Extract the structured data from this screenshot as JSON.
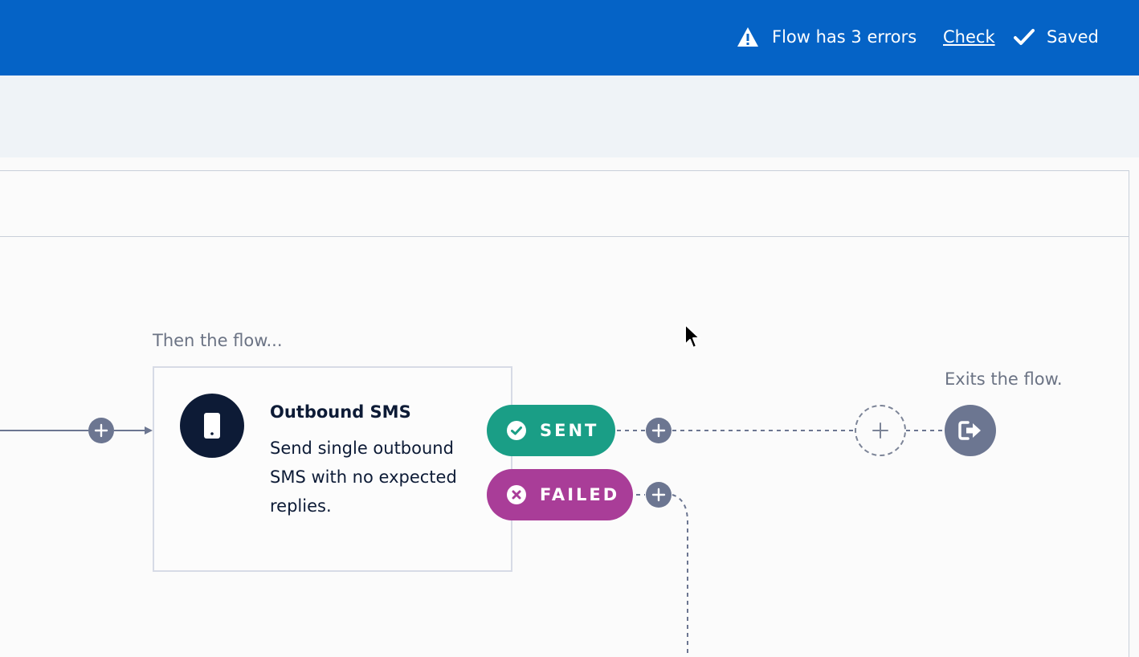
{
  "header": {
    "error_status": "Flow has 3 errors",
    "check_link": "Check",
    "saved_status": "Saved"
  },
  "canvas": {
    "then_label": "Then the flow...",
    "exits_label": "Exits the flow.",
    "node": {
      "title": "Outbound SMS",
      "description": "Send single outbound SMS with no expected replies."
    },
    "outcomes": [
      {
        "label": "SENT",
        "color": "#1a9e86"
      },
      {
        "label": "FAILED",
        "color": "#a93d98"
      }
    ]
  },
  "colors": {
    "header_bg": "#0563c6",
    "node_icon_bg": "#0d1b36",
    "connector": "#6c7691"
  },
  "icons": {
    "warning": "warning-icon",
    "saved": "checkmark-icon",
    "node": "phone-icon",
    "sent": "check-circle-icon",
    "failed": "x-circle-icon",
    "add": "plus-icon",
    "exit": "exit-icon"
  }
}
